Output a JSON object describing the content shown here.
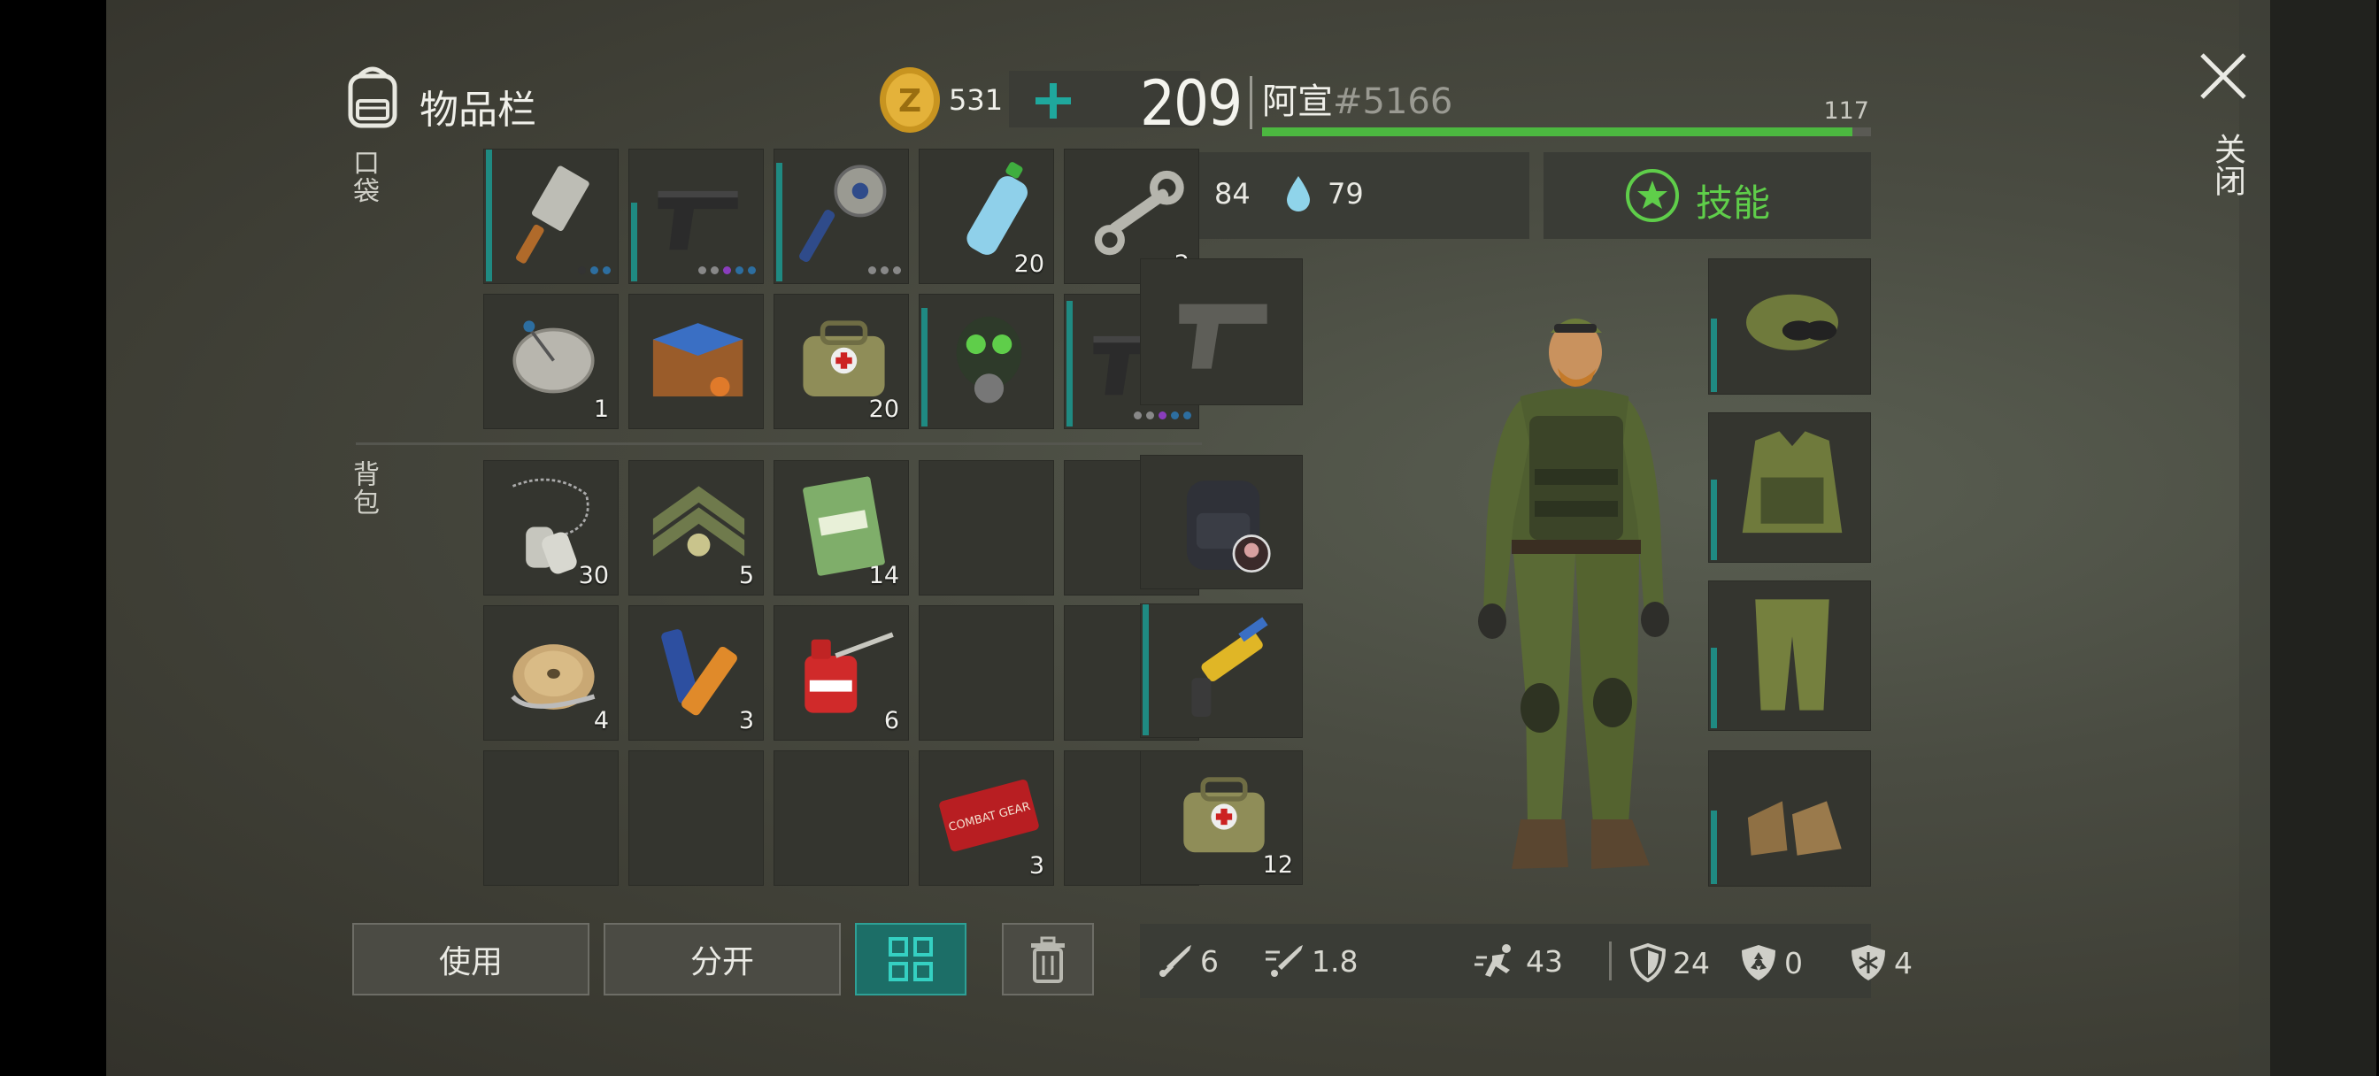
{
  "inventory": {
    "title": "物品栏",
    "coins": "531",
    "pockets_label": "口袋",
    "backpack_label": "背包",
    "pockets": [
      {
        "icon": "cleaver-icon",
        "count": "",
        "dots": [
          "#333",
          "#2d6ea0",
          "#2d6ea0"
        ]
      },
      {
        "icon": "pistol-icon",
        "count": "",
        "dots": [
          "#888",
          "#888",
          "#8a3dbd",
          "#2d6ea0",
          "#2d6ea0"
        ]
      },
      {
        "icon": "saw-mace-icon",
        "count": "",
        "dots": [
          "#888",
          "#888",
          "#888"
        ]
      },
      {
        "icon": "water-bottle-icon",
        "count": "20",
        "dots": []
      },
      {
        "icon": "wrench-icon",
        "count": "2",
        "dots": []
      },
      {
        "icon": "satellite-dish-icon",
        "count": "1",
        "dots": []
      },
      {
        "icon": "crate-icon",
        "count": "",
        "dots": []
      },
      {
        "icon": "medkit-bag-icon",
        "count": "20",
        "dots": []
      },
      {
        "icon": "gas-mask-icon",
        "count": "",
        "dots": []
      },
      {
        "icon": "pistol-icon",
        "count": "",
        "dots": [
          "#888",
          "#888",
          "#8a3dbd",
          "#2d6ea0",
          "#2d6ea0"
        ]
      }
    ],
    "backpack": [
      {
        "icon": "dog-tags-icon",
        "count": "30"
      },
      {
        "icon": "sergeant-badge-icon",
        "count": "5"
      },
      {
        "icon": "notebook-icon",
        "count": "14"
      },
      {
        "icon": "",
        "count": ""
      },
      {
        "icon": "",
        "count": ""
      },
      {
        "icon": "wire-spool-icon",
        "count": "4"
      },
      {
        "icon": "batteries-icon",
        "count": "3"
      },
      {
        "icon": "oil-can-icon",
        "count": "6"
      },
      {
        "icon": "",
        "count": ""
      },
      {
        "icon": "",
        "count": ""
      },
      {
        "icon": "",
        "count": ""
      },
      {
        "icon": "",
        "count": ""
      },
      {
        "icon": "",
        "count": ""
      },
      {
        "icon": "coupon-icon",
        "count": "3"
      },
      {
        "icon": "",
        "count": ""
      }
    ],
    "buttons": {
      "use": "使用",
      "split": "分开"
    }
  },
  "character": {
    "level": "209",
    "name": "阿宣",
    "tag": "#5166",
    "xp": "117",
    "xp_fraction": 0.97,
    "hunger": "84",
    "thirst": "79",
    "skills_label": "技能",
    "weapon_slots": [
      {
        "icon": "pistol-silhouette-icon",
        "count": ""
      },
      {
        "icon": "backpack-icon",
        "count": ""
      },
      {
        "icon": "nail-gun-icon",
        "count": ""
      },
      {
        "icon": "medkit-bag-icon",
        "count": "12"
      }
    ],
    "armor_slots": [
      "camo-cap-icon",
      "armor-vest-icon",
      "camo-pants-icon",
      "boots-icon"
    ],
    "stats": {
      "damage": "6",
      "attack_speed": "1.8",
      "move_speed": "43",
      "armor": "24",
      "radiation": "0",
      "cold": "4"
    }
  },
  "close_label": "关闭",
  "colors": {
    "accent_teal": "#1f8a82",
    "xp_green": "#4cb840",
    "skill_green": "#5fce4a"
  }
}
